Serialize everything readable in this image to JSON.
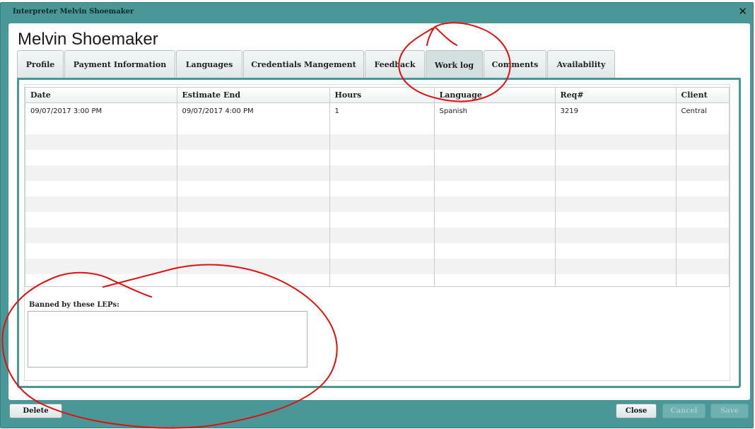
{
  "window": {
    "title": "Interpreter Melvin Shoemaker",
    "close_glyph": "✕"
  },
  "profile": {
    "name": "Melvin Shoemaker"
  },
  "tabs": [
    {
      "label": "Profile"
    },
    {
      "label": "Payment Information"
    },
    {
      "label": "Languages"
    },
    {
      "label": "Credentials Mangement"
    },
    {
      "label": "Feedback"
    },
    {
      "label": "Work log",
      "active": true
    },
    {
      "label": "Comments"
    },
    {
      "label": "Availability"
    }
  ],
  "worklog": {
    "columns": [
      "Date",
      "Estimate End",
      "Hours",
      "Language",
      "Req#",
      "Client"
    ],
    "rows": [
      [
        "09/07/2017  3:00 PM",
        "09/07/2017  4:00 PM",
        "1",
        "Spanish",
        "3219",
        "Central"
      ]
    ]
  },
  "banned": {
    "label": "Banned by these LEPs:",
    "value": ""
  },
  "footer": {
    "delete_label": "Delete",
    "close_label": "Close",
    "cancel_label": "Cancel",
    "save_label": "Save"
  },
  "colors": {
    "frame": "#4a9797",
    "annotation": "#e01010"
  }
}
